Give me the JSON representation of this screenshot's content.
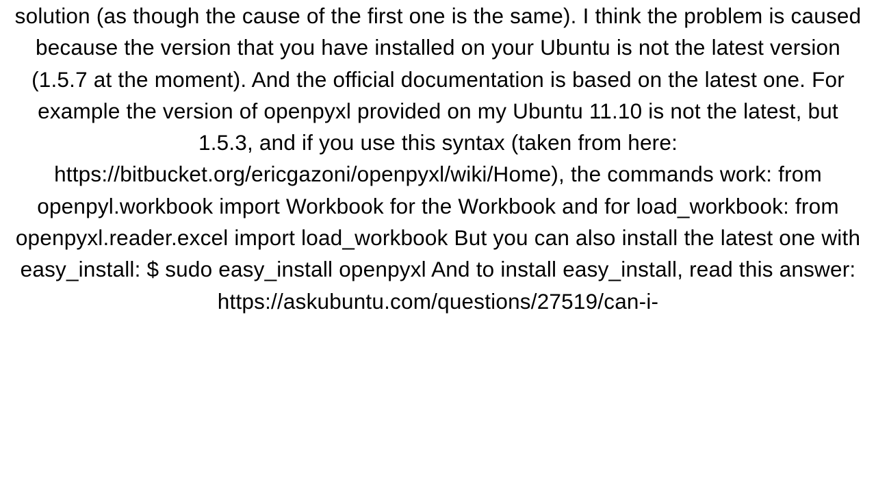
{
  "document": {
    "paragraph": "solution (as though the cause of the first one is the same). I think the problem is caused because the version that you have installed on your Ubuntu is  not the latest version (1.5.7 at the moment). And the official documentation is based on the latest one. For example the version of openpyxl provided on my Ubuntu 11.10 is not the latest, but 1.5.3, and if you use this syntax (taken from here: https://bitbucket.org/ericgazoni/openpyxl/wiki/Home), the commands work: from openpyl.workbook import Workbook  for the Workbook and for load_workbook: from openpyxl.reader.excel import load_workbook  But you can also install the latest one with easy_install: $ sudo easy_install openpyxl  And to install easy_install, read this answer: https://askubuntu.com/questions/27519/can-i-"
  }
}
